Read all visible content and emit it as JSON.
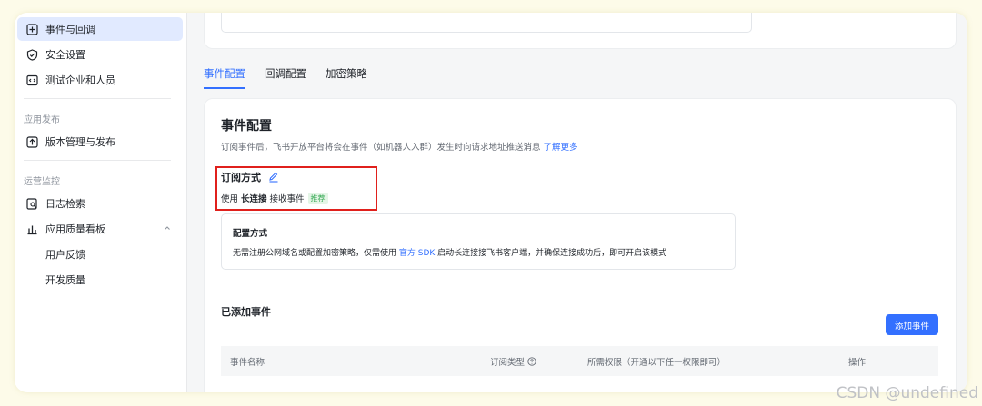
{
  "sidebar": {
    "items": [
      {
        "label": "事件与回调"
      },
      {
        "label": "安全设置"
      },
      {
        "label": "测试企业和人员"
      }
    ],
    "section_publish": "应用发布",
    "publish_items": [
      {
        "label": "版本管理与发布"
      }
    ],
    "section_monitor": "运营监控",
    "monitor_items": [
      {
        "label": "日志检索"
      },
      {
        "label": "应用质量看板"
      },
      {
        "label": "用户反馈"
      },
      {
        "label": "开发质量"
      }
    ]
  },
  "tabs": [
    {
      "label": "事件配置"
    },
    {
      "label": "回调配置"
    },
    {
      "label": "加密策略"
    }
  ],
  "event_config": {
    "title": "事件配置",
    "desc": "订阅事件后，飞书开放平台将会在事件（如机器人入群）发生时向请求地址推送消息",
    "learn_more": "了解更多",
    "subscribe_title": "订阅方式",
    "mode_prefix": "使用",
    "mode_name": "长连接",
    "mode_suffix": "接收事件",
    "mode_badge": "推荐",
    "config_title": "配置方式",
    "config_desc_1": "无需注册公网域名或配置加密策略，仅需使用",
    "config_link": "官方 SDK",
    "config_desc_2": "启动长连接接飞书客户端，并确保连接成功后，即可开启该模式"
  },
  "added_events": {
    "title": "已添加事件",
    "add_button": "添加事件",
    "columns": [
      "事件名称",
      "订阅类型",
      "所需权限（开通以下任一权限即可）",
      "操作"
    ]
  },
  "watermark": "CSDN @undefined",
  "colors": {
    "accent": "#3370ff",
    "highlight": "#e0201c",
    "badge": "#34a853"
  }
}
